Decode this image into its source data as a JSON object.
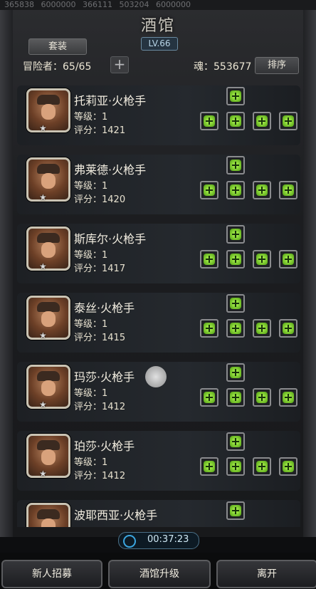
{
  "top_strip": [
    "365838",
    "6000000",
    "366111",
    "503204",
    "6000000"
  ],
  "header": {
    "title": "酒馆",
    "level": "LV.66",
    "set_button": "套装",
    "adventurers": "冒险者：65/65",
    "add_symbol": "+",
    "soul": "魂：553677",
    "sort_button": "排序"
  },
  "adventurers": [
    {
      "name": "托莉亚·火枪手",
      "level": "等级：1",
      "score": "评分：1421"
    },
    {
      "name": "弗莱德·火枪手",
      "level": "等级：1",
      "score": "评分：1420"
    },
    {
      "name": "斯库尔·火枪手",
      "level": "等级：1",
      "score": "评分：1417"
    },
    {
      "name": "泰丝·火枪手",
      "level": "等级：1",
      "score": "评分：1415"
    },
    {
      "name": "玛莎·火枪手",
      "level": "等级：1",
      "score": "评分：1412"
    },
    {
      "name": "珀莎·火枪手",
      "level": "等级：1",
      "score": "评分：1412"
    },
    {
      "name": "波耶西亚·火枪手",
      "level": "",
      "score": ""
    }
  ],
  "footer": {
    "timer": "00:37:23",
    "recruit": "新人招募",
    "upgrade": "酒馆升级",
    "leave": "离开"
  }
}
